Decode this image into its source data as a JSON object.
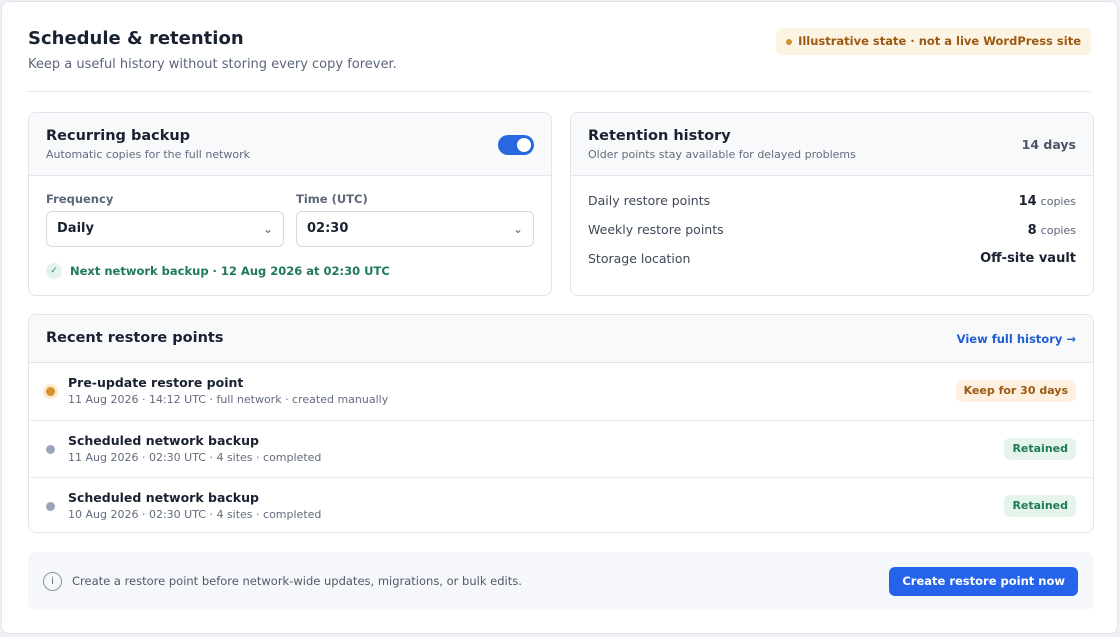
{
  "header": {
    "title": "Schedule & retention",
    "subtitle": "Keep a useful history without storing every copy forever.",
    "notice": "Illustrative state · not a live WordPress site"
  },
  "backup": {
    "title": "Recurring backup",
    "subtitle": "Automatic copies for the full network",
    "enabled": true,
    "frequency_label": "Frequency",
    "frequency_value": "Daily",
    "time_label": "Time (UTC)",
    "time_value": "02:30",
    "next_run": "Next network backup · 12 Aug 2026 at 02:30 UTC"
  },
  "retention": {
    "title": "Retention history",
    "subtitle": "Older points stay available for delayed problems",
    "days": "14 days",
    "rows": [
      {
        "label": "Daily restore points",
        "count": "14",
        "unit": "copies"
      },
      {
        "label": "Weekly restore points",
        "count": "8",
        "unit": "copies"
      },
      {
        "label": "Storage location",
        "value": "Off-site vault"
      }
    ]
  },
  "recent": {
    "title": "Recent restore points",
    "link": "View full history →",
    "items": [
      {
        "name": "Pre-update restore point",
        "meta": "11 Aug 2026 · 14:12 UTC · full network · created manually",
        "badge": "Keep for 30 days"
      },
      {
        "name": "Scheduled network backup",
        "meta": "11 Aug 2026 · 02:30 UTC · 4 sites · completed",
        "badge": "Retained"
      },
      {
        "name": "Scheduled network backup",
        "meta": "10 Aug 2026 · 02:30 UTC · 4 sites · completed",
        "badge": "Retained"
      }
    ]
  },
  "footer": {
    "text": "Create a restore point before network-wide updates, migrations, or bulk edits.",
    "button": "Create restore point now"
  },
  "colors": {
    "accent": "#2563eb",
    "success": "#1f7a55",
    "warning": "#d9922b"
  }
}
